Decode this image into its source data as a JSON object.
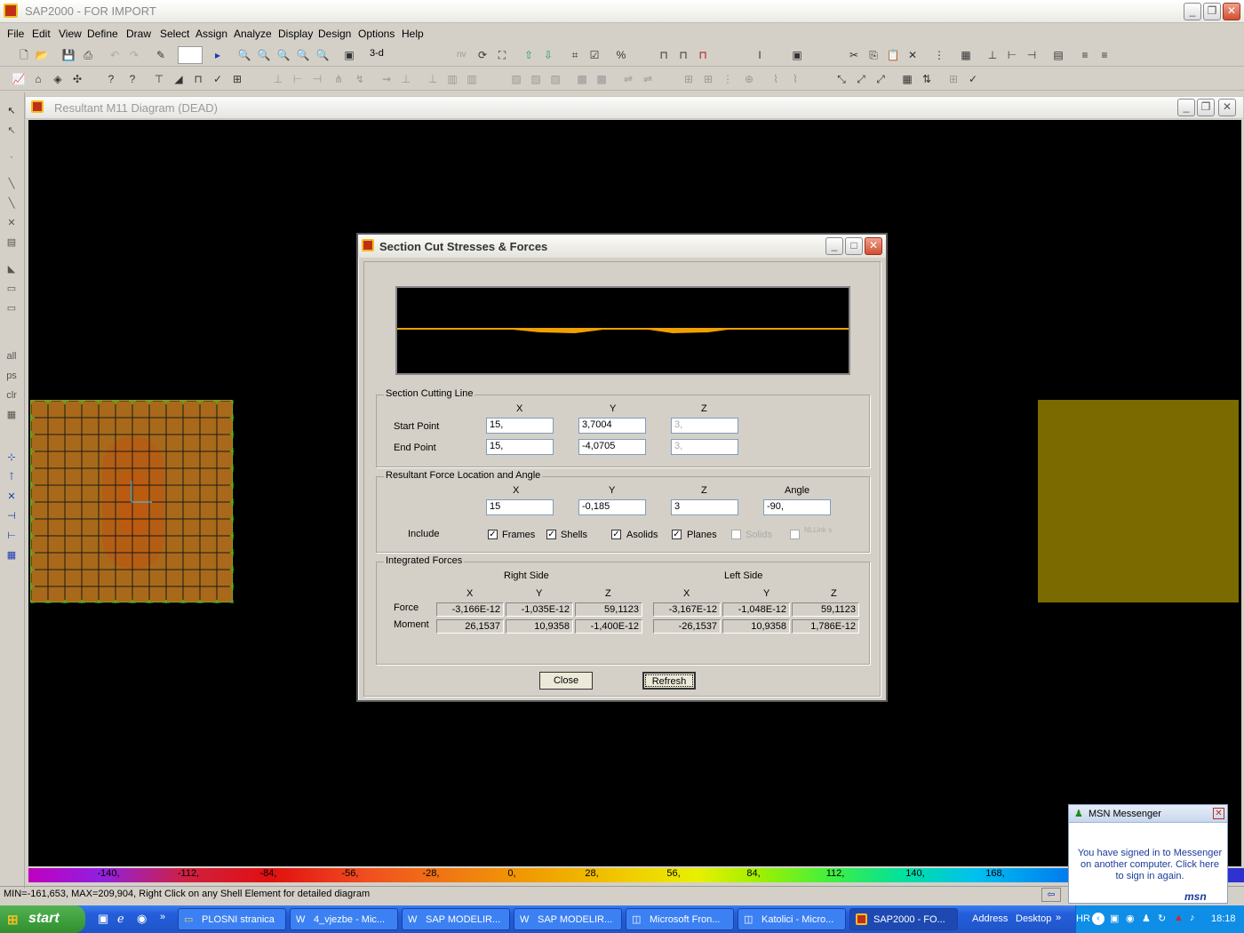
{
  "app": {
    "title": "SAP2000 - FOR IMPORT"
  },
  "menu": [
    "File",
    "Edit",
    "View",
    "Define",
    "Draw",
    "Select",
    "Assign",
    "Analyze",
    "Display",
    "Design",
    "Options",
    "Help"
  ],
  "toolbar": {
    "view_label": "3-d",
    "units_hint": "nv"
  },
  "child_window": {
    "title": "Resultant M11 Diagram   (DEAD)"
  },
  "dialog": {
    "title": "Section Cut Stresses & Forces",
    "cutting_line": {
      "group_label": "Section Cutting Line",
      "headers": [
        "X",
        "Y",
        "Z"
      ],
      "rows": [
        {
          "label": "Start Point",
          "x": "15,",
          "y": "3,7004",
          "z": "3,"
        },
        {
          "label": "End Point",
          "x": "15,",
          "y": "-4,0705",
          "z": "3,"
        }
      ]
    },
    "resultant": {
      "group_label": "Resultant Force Location and Angle",
      "headers": [
        "X",
        "Y",
        "Z",
        "Angle"
      ],
      "values": {
        "x": "15",
        "y": "-0,185",
        "z": "3",
        "angle": "-90,"
      },
      "include_label": "Include",
      "checks": [
        {
          "label": "Frames",
          "checked": true,
          "enabled": true
        },
        {
          "label": "Shells",
          "checked": true,
          "enabled": true
        },
        {
          "label": "Asolids",
          "checked": true,
          "enabled": true
        },
        {
          "label": "Planes",
          "checked": true,
          "enabled": true
        },
        {
          "label": "Solids",
          "checked": false,
          "enabled": false
        },
        {
          "label": "NLLink s",
          "checked": false,
          "enabled": false
        }
      ]
    },
    "integrated": {
      "group_label": "Integrated Forces",
      "right_side": "Right Side",
      "left_side": "Left Side",
      "axes": [
        "X",
        "Y",
        "Z"
      ],
      "rows": [
        {
          "label": "Force",
          "right": [
            "-3,166E-12",
            "-1,035E-12",
            "59,1123"
          ],
          "left": [
            "-3,167E-12",
            "-1,048E-12",
            "59,1123"
          ]
        },
        {
          "label": "Moment",
          "right": [
            "26,1537",
            "10,9358",
            "-1,400E-12"
          ],
          "left": [
            "-26,1537",
            "10,9358",
            "1,786E-12"
          ]
        }
      ]
    },
    "close_label": "Close",
    "refresh_label": "Refresh"
  },
  "color_scale": [
    "-140,",
    "-112,",
    "-84,",
    "-56,",
    "-28,",
    "0,",
    "28,",
    "56,",
    "84,",
    "112,",
    "140,",
    "168,"
  ],
  "status": {
    "text": "MIN=-161,653, MAX=209,904, Right Click on any Shell Element for detailed diagram"
  },
  "msn": {
    "title": "MSN Messenger",
    "message": "You have signed in to Messenger on another computer. Click here to sign in again.",
    "logo": "msn"
  },
  "taskbar": {
    "start": "start",
    "tasks": [
      "PLOSNI stranica",
      "4_vjezbe - Mic...",
      "SAP MODELIR...",
      "SAP MODELIR...",
      "Microsoft Fron...",
      "Katolici - Micro...",
      "SAP2000 - FO..."
    ],
    "address": "Address",
    "desktop": "Desktop",
    "lang": "HR",
    "clock": "18:18"
  }
}
